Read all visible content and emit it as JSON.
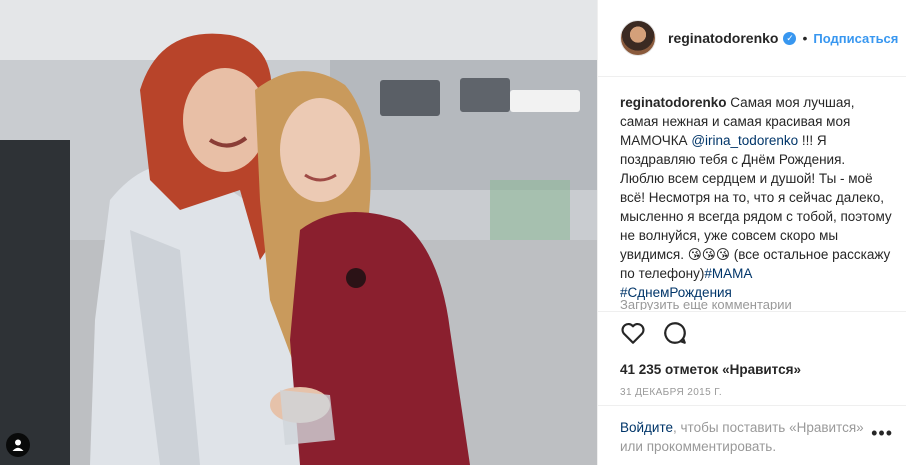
{
  "post": {
    "username": "reginatodorenko",
    "verified_badge": "✓",
    "dot": "•",
    "follow_label": "Подписаться",
    "caption_part1": "Самая моя лучшая, самая нежная и самая красивая моя МАМОЧКА ",
    "mention": "@irina_todorenko",
    "caption_part2": " !!! Я поздравляю тебя с Днём Рождения. Люблю всем сердцем и душой! Ты - моё всё! Несмотря на то, что я сейчас далеко, мысленно я всегда рядом с тобой, поэтому не волнуйся, уже совсем скоро мы увидимся. 😘😘😘 (все остальное расскажу по телефону)",
    "hashtag1": "#МАМА",
    "hashtag2": "#СднемРождения",
    "load_more": "Загрузить еще комментарии",
    "likes": "41 235 отметок «Нравится»",
    "date": "31 декабря 2015 г.",
    "login_link": "Войдите",
    "login_text": ", чтобы поставить «Нравится» или прокомментировать.",
    "more_options": "•••"
  },
  "icons": {
    "like": "heart-icon",
    "comment": "comment-icon",
    "user_tag": "user-tag-icon",
    "verified": "verified-badge-icon",
    "more": "more-options-icon"
  },
  "colors": {
    "accent": "#3897f0",
    "link": "#003569",
    "muted": "#999999",
    "text": "#262626",
    "divider": "#efefef"
  }
}
